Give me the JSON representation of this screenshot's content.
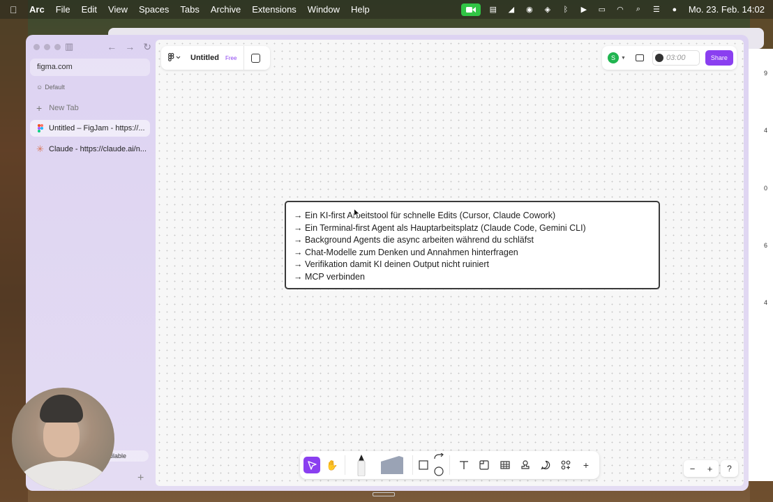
{
  "menubar": {
    "app_name": "Arc",
    "items": [
      "File",
      "Edit",
      "View",
      "Spaces",
      "Tabs",
      "Archive",
      "Extensions",
      "Window",
      "Help"
    ],
    "clock": "Mo. 23. Feb.  14:02"
  },
  "sidebar": {
    "url": "figma.com",
    "space_name": "Default",
    "new_tab_label": "New Tab",
    "tabs": [
      {
        "label": "Untitled – FigJam - https://..."
      },
      {
        "label": "Claude - https://claude.ai/n..."
      }
    ],
    "available_label": "ailable"
  },
  "figjam": {
    "file_title": "Untitled",
    "plan_badge": "Free",
    "avatar_initial": "S",
    "timer": "03:00",
    "share_label": "Share",
    "text_lines": [
      "→ Ein KI-first Arbeitstool für schnelle Edits (Cursor, Claude Cowork)",
      "→ Ein Terminal-first Agent als Hauptarbeitsplatz (Claude Code, Gemini CLI)",
      "→ Background Agents die async arbeiten während du schläfst",
      "→ Chat-Modelle zum Denken und Annahmen hinterfragen",
      "→ Verifikation damit KI deinen Output nicht ruiniert",
      "→ MCP verbinden"
    ],
    "zoom_minus": "−",
    "zoom_plus": "+",
    "help_label": "?"
  },
  "background_window": {
    "side_numbers": [
      "9",
      "4",
      "0",
      "6",
      "4"
    ]
  },
  "colors": {
    "accent": "#8a3ff0",
    "avatar": "#20b550",
    "recording": "#31c545"
  }
}
